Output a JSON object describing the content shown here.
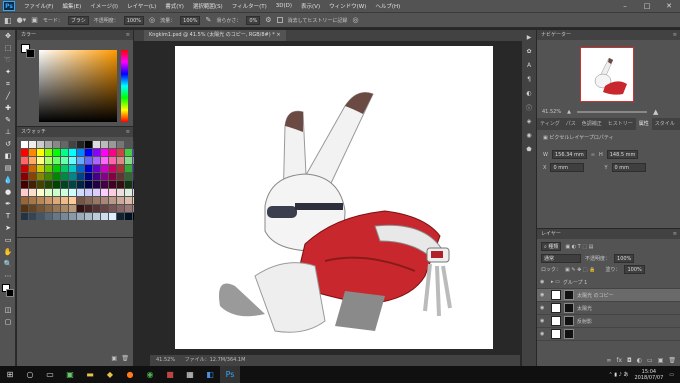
{
  "app": {
    "logo": "Ps"
  },
  "menu": [
    "ファイル(F)",
    "編集(E)",
    "イメージ(I)",
    "レイヤー(L)",
    "書式(Y)",
    "選択範囲(S)",
    "フィルター(T)",
    "3D(D)",
    "表示(V)",
    "ウィンドウ(W)",
    "ヘルプ(H)"
  ],
  "window_controls": [
    "–",
    "□",
    "✕"
  ],
  "options": {
    "mode_label": "モード：",
    "mode_value": "ブラシ",
    "opacity_label": "不透明度：",
    "opacity_value": "100%",
    "flow_label": "流量：",
    "flow_value": "100%",
    "smooth_label": "滑らかさ：",
    "smooth_value": "0%",
    "history_label": "消去してヒストリーに記録"
  },
  "color_panel": {
    "title": "カラー"
  },
  "swatch_panel": {
    "title": "スウォッチ"
  },
  "document": {
    "tab_title": "Kngkim1.psd @ 41.5% (太陽光 のコピー, RGB/8#) *",
    "close": "×"
  },
  "status": {
    "zoom": "41.52%",
    "file": "ファイル：12.7M/364.1M"
  },
  "navigator": {
    "title": "ナビゲーター",
    "zoom": "41.52%"
  },
  "properties": {
    "tabs": [
      "ティング",
      "パス",
      "色調補正",
      "ヒストリー",
      "属性",
      "スタイル"
    ],
    "subtitle": "ピクセルレイヤープロパティ",
    "w_label": "W",
    "w_value": "156.34 mm",
    "h_label": "H",
    "h_value": "148.5 mm",
    "x_label": "X",
    "x_value": "0 mm",
    "y_label": "Y",
    "y_value": "0 mm"
  },
  "layers": {
    "title": "レイヤー",
    "filter": "種類",
    "blend": "通常",
    "opacity_label": "不透明度：",
    "opacity_value": "100%",
    "lock_label": "ロック：",
    "fill_label": "塗り：",
    "fill_value": "100%",
    "items": [
      {
        "name": "グループ 1"
      },
      {
        "name": "太陽光 のコピー"
      },
      {
        "name": "太陽光"
      },
      {
        "name": "反射影"
      },
      {
        "name": ""
      }
    ]
  },
  "taskbar": {
    "time": "15:04",
    "date": "2018/07/07"
  },
  "colors": {
    "panel": "#535353",
    "dark": "#424242",
    "canvas_bg": "#282828",
    "accent": "#31a8ff",
    "jacket": "#c8282d"
  }
}
